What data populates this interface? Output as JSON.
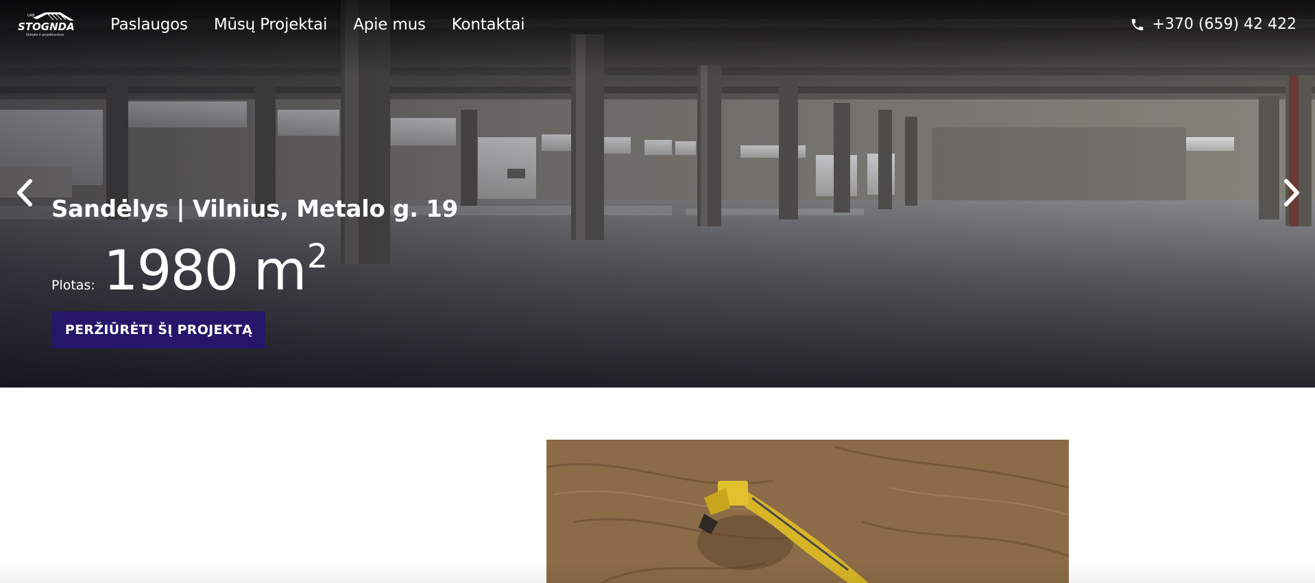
{
  "brand": {
    "logo_text": "STOGNDA",
    "logo_subtext": "UAB",
    "logo_tagline": "Statyba ir projektavimas"
  },
  "nav": {
    "items": [
      {
        "label": "Paslaugos"
      },
      {
        "label": "Mūsų Projektai"
      },
      {
        "label": "Apie mus"
      },
      {
        "label": "Kontaktai"
      }
    ]
  },
  "contact": {
    "phone": "+370 (659) 42 422",
    "icon": "phone-icon"
  },
  "slider": {
    "title": "Sandėlys | Vilnius, Metalo g. 19",
    "area_label": "Plotas:",
    "area_value": "1980 m",
    "area_unit_sup": "2",
    "cta_label": "PERŽIŪRĖTI ŠĮ PROJEKTĄ",
    "prev_icon": "chevron-left-icon",
    "next_icon": "chevron-right-icon"
  },
  "colors": {
    "cta_bg": "#26166a",
    "text_on_dark": "#ffffff"
  }
}
